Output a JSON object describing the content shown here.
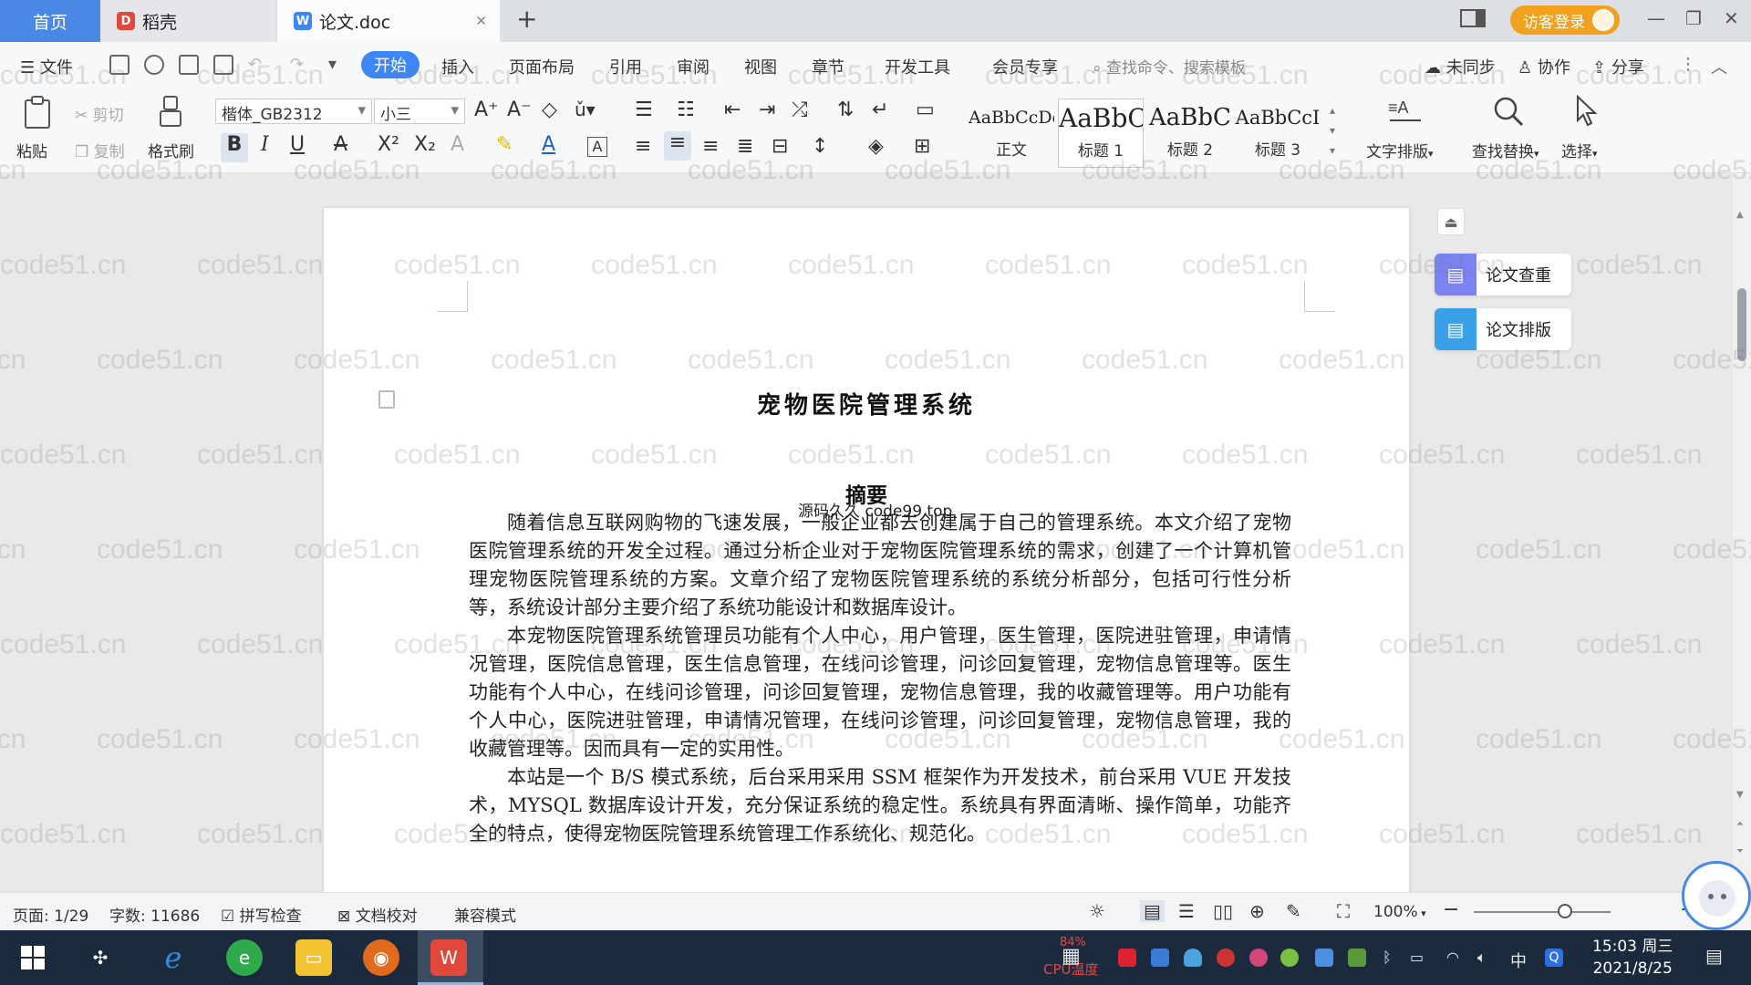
{
  "tabs": {
    "home": "首页",
    "daoke": "稻壳",
    "doc": "论文.doc"
  },
  "titlebar": {
    "login": "访客登录"
  },
  "menu": {
    "file": "文件",
    "items": [
      "开始",
      "插入",
      "页面布局",
      "引用",
      "审阅",
      "视图",
      "章节",
      "开发工具",
      "会员专享"
    ],
    "search_placeholder": "查找命令、搜索模板",
    "sync": "未同步",
    "collab": "协作",
    "share": "分享"
  },
  "ribbon": {
    "paste": "粘贴",
    "cut": "剪切",
    "copy": "复制",
    "format_painter": "格式刷",
    "font_name": "楷体_GB2312",
    "font_size": "小三",
    "styles": [
      {
        "sample": "AaBbCcDd",
        "label": "正文"
      },
      {
        "sample": "AaBbC",
        "label": "标题 1"
      },
      {
        "sample": "AaBbC",
        "label": "标题 2"
      },
      {
        "sample": "AaBbCcI",
        "label": "标题 3"
      }
    ],
    "text_layout": "文字排版",
    "find_replace": "查找替换",
    "select": "选择"
  },
  "side_panel": {
    "check": "论文查重",
    "layout": "论文排版"
  },
  "document": {
    "title": "宠物医院管理系统",
    "abstract_heading": "摘要",
    "stamp": "源码久久 code99.top",
    "paragraphs": [
      "随着信息互联网购物的飞速发展，一般企业都去创建属于自己的管理系统。本文介绍了宠物医院管理系统的开发全过程。通过分析企业对于宠物医院管理系统的需求，创建了一个计算机管理宠物医院管理系统的方案。文章介绍了宠物医院管理系统的系统分析部分，包括可行性分析等，系统设计部分主要介绍了系统功能设计和数据库设计。",
      "本宠物医院管理系统管理员功能有个人中心，用户管理，医生管理，医院进驻管理，申请情况管理，医院信息管理，医生信息管理，在线问诊管理，问诊回复管理，宠物信息管理等。医生功能有个人中心，在线问诊管理，问诊回复管理，宠物信息管理，我的收藏管理等。用户功能有个人中心，医院进驻管理，申请情况管理，在线问诊管理，问诊回复管理，宠物信息管理，我的收藏管理等。因而具有一定的实用性。",
      "本站是一个 B/S 模式系统，后台采用采用 SSM 框架作为开发技术，前台采用 VUE 开发技术，MYSQL 数据库设计开发，充分保证系统的稳定性。系统具有界面清晰、操作简单，功能齐全的特点，使得宠物医院管理系统管理工作系统化、规范化。"
    ]
  },
  "watermark": "code51.cn",
  "statusbar": {
    "page": "页面: 1/29",
    "words": "字数: 11686",
    "spell": "拼写检查",
    "proof": "文档校对",
    "compat": "兼容模式",
    "zoom": "100%"
  },
  "taskbar": {
    "cpu_pct": "84%",
    "cpu_temp": "CPU温度",
    "ime": "中",
    "time": "15:03 周三",
    "date": "2021/8/25"
  },
  "colors": {
    "accent": "#3e86f5",
    "home_tab": "#4a88e6",
    "login": "#f2a11e",
    "taskbar": "#1c2a3d"
  }
}
